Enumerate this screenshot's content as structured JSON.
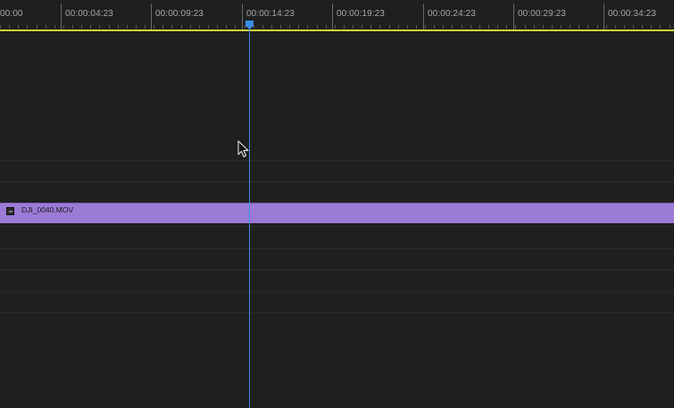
{
  "ruler": {
    "timecodes": [
      "00:00",
      "00:00:04:23",
      "00:00:09:23",
      "00:00:14:23",
      "00:00:19:23",
      "00:00:24:23",
      "00:00:29:23",
      "00:00:34:23"
    ]
  },
  "clip": {
    "name": "DJI_0040.MOV",
    "color": "#9b7bd6",
    "icon": "video-clip-icon"
  },
  "playhead": {
    "color": "#3a8ee6",
    "timecode_marker": "00:00:14:23"
  },
  "work_area_color": "#d8d23a",
  "cursor_icon": "mouse-pointer-icon"
}
